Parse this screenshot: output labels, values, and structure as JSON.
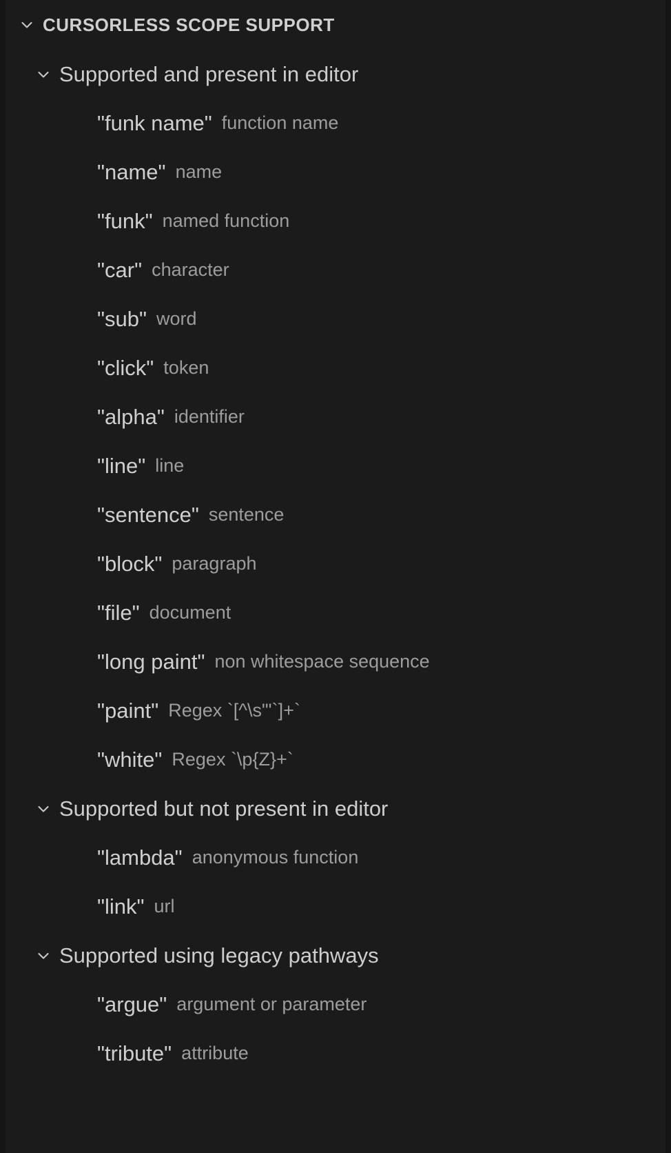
{
  "theme": {
    "background": "#1b1b1b",
    "edge": "#141414",
    "label_color": "#cfcfcf",
    "description_color": "#9d9d9d",
    "chevron_color": "#c8c8c8"
  },
  "panel": {
    "title": "CURSORLESS SCOPE SUPPORT",
    "expanded": true,
    "chevron_icon": "chevron-down-icon"
  },
  "sections": [
    {
      "title": "Supported and present in editor",
      "expanded": true,
      "chevron_icon": "chevron-down-icon",
      "items": [
        {
          "label": "\"funk name\"",
          "description": "function name"
        },
        {
          "label": "\"name\"",
          "description": "name"
        },
        {
          "label": "\"funk\"",
          "description": "named function"
        },
        {
          "label": "\"car\"",
          "description": "character"
        },
        {
          "label": "\"sub\"",
          "description": "word"
        },
        {
          "label": "\"click\"",
          "description": "token"
        },
        {
          "label": "\"alpha\"",
          "description": "identifier"
        },
        {
          "label": "\"line\"",
          "description": "line"
        },
        {
          "label": "\"sentence\"",
          "description": "sentence"
        },
        {
          "label": "\"block\"",
          "description": "paragraph"
        },
        {
          "label": "\"file\"",
          "description": "document"
        },
        {
          "label": "\"long paint\"",
          "description": "non whitespace sequence"
        },
        {
          "label": "\"paint\"",
          "description": "Regex `[^\\s\"'`]+`"
        },
        {
          "label": "\"white\"",
          "description": "Regex `\\p{Z}+`"
        }
      ]
    },
    {
      "title": "Supported but not present in editor",
      "expanded": true,
      "chevron_icon": "chevron-down-icon",
      "items": [
        {
          "label": "\"lambda\"",
          "description": "anonymous function"
        },
        {
          "label": "\"link\"",
          "description": "url"
        }
      ]
    },
    {
      "title": "Supported using legacy pathways",
      "expanded": true,
      "chevron_icon": "chevron-down-icon",
      "items": [
        {
          "label": "\"argue\"",
          "description": "argument or parameter"
        },
        {
          "label": "\"tribute\"",
          "description": "attribute"
        }
      ]
    }
  ]
}
